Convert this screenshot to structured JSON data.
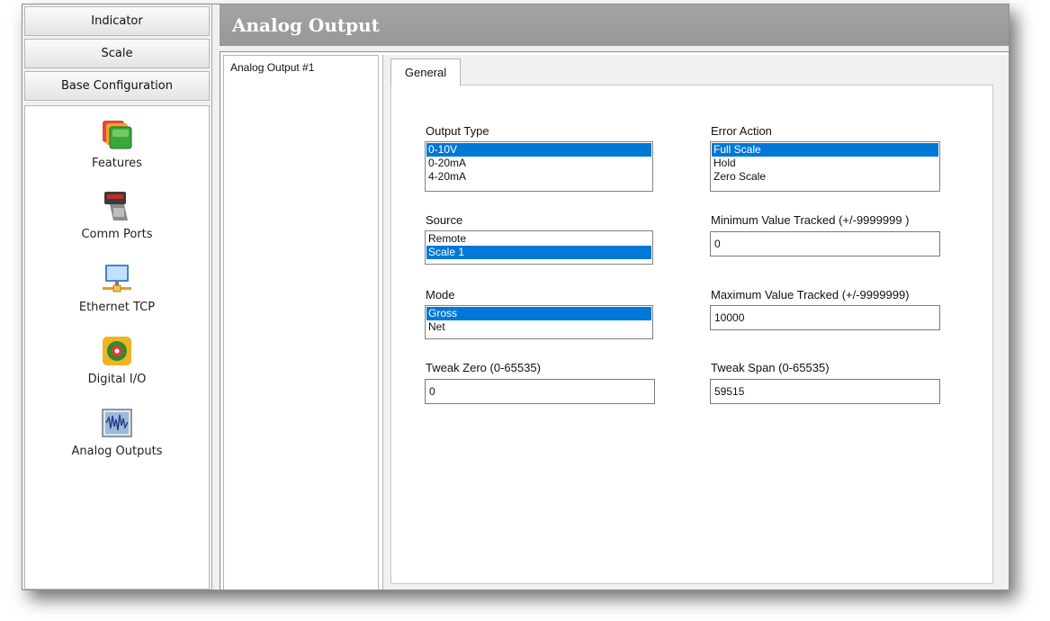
{
  "nav": {
    "buttons": [
      "Indicator",
      "Scale",
      "Base Configuration"
    ],
    "items": [
      {
        "label": "Features",
        "icon": "features-icon"
      },
      {
        "label": "Comm Ports",
        "icon": "comm-ports-icon"
      },
      {
        "label": "Ethernet TCP",
        "icon": "ethernet-icon"
      },
      {
        "label": "Digital I/O",
        "icon": "digital-io-icon"
      },
      {
        "label": "Analog Outputs",
        "icon": "analog-outputs-icon"
      }
    ]
  },
  "header": {
    "title": "Analog Output"
  },
  "tree": {
    "items": [
      "Analog Output #1"
    ]
  },
  "tabs": [
    {
      "label": "General"
    }
  ],
  "form": {
    "output_type": {
      "label": "Output Type",
      "options": [
        "0-10V",
        "0-20mA",
        "4-20mA"
      ],
      "selected": "0-10V"
    },
    "error_action": {
      "label": "Error Action",
      "options": [
        "Full Scale",
        "Hold",
        "Zero Scale"
      ],
      "selected": "Full Scale"
    },
    "source": {
      "label": "Source",
      "options": [
        "Remote",
        "Scale 1"
      ],
      "selected": "Scale 1"
    },
    "min_value": {
      "label": "Minimum Value Tracked  (+/-9999999 )",
      "value": "0"
    },
    "mode": {
      "label": "Mode",
      "options": [
        "Gross",
        "Net"
      ],
      "selected": "Gross"
    },
    "max_value": {
      "label": "Maximum Value Tracked  (+/-9999999)",
      "value": "10000"
    },
    "tweak_zero": {
      "label": "Tweak Zero (0-65535)",
      "value": "0"
    },
    "tweak_span": {
      "label": "Tweak Span (0-65535)",
      "value": "59515"
    }
  },
  "colors": {
    "selection": "#0078d7",
    "header": "#9e9e9e"
  }
}
